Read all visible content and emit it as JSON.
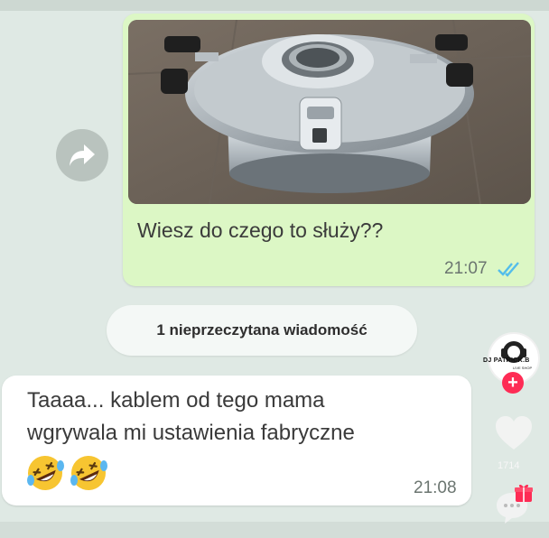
{
  "outgoing": {
    "text": "Wiesz do czego to służy??",
    "time": "21:07",
    "status_icon": "double-check-icon",
    "status_color": "#53bdeb"
  },
  "unread_banner": "1 nieprzeczytana wiadomość",
  "incoming": {
    "line1": "Taaaa... kablem od tego mama",
    "line2": "wgrywala mi ustawienia fabryczne",
    "emoji": [
      "rolling-on-floor-laughing-icon",
      "rolling-on-floor-laughing-icon"
    ],
    "time": "21:08"
  },
  "overlay": {
    "profile_name": "DJ PATRICK.B",
    "profile_sub": "LIVE SHOP",
    "follow_label": "+",
    "like_count": "1714",
    "accent": "#fe2c55"
  }
}
